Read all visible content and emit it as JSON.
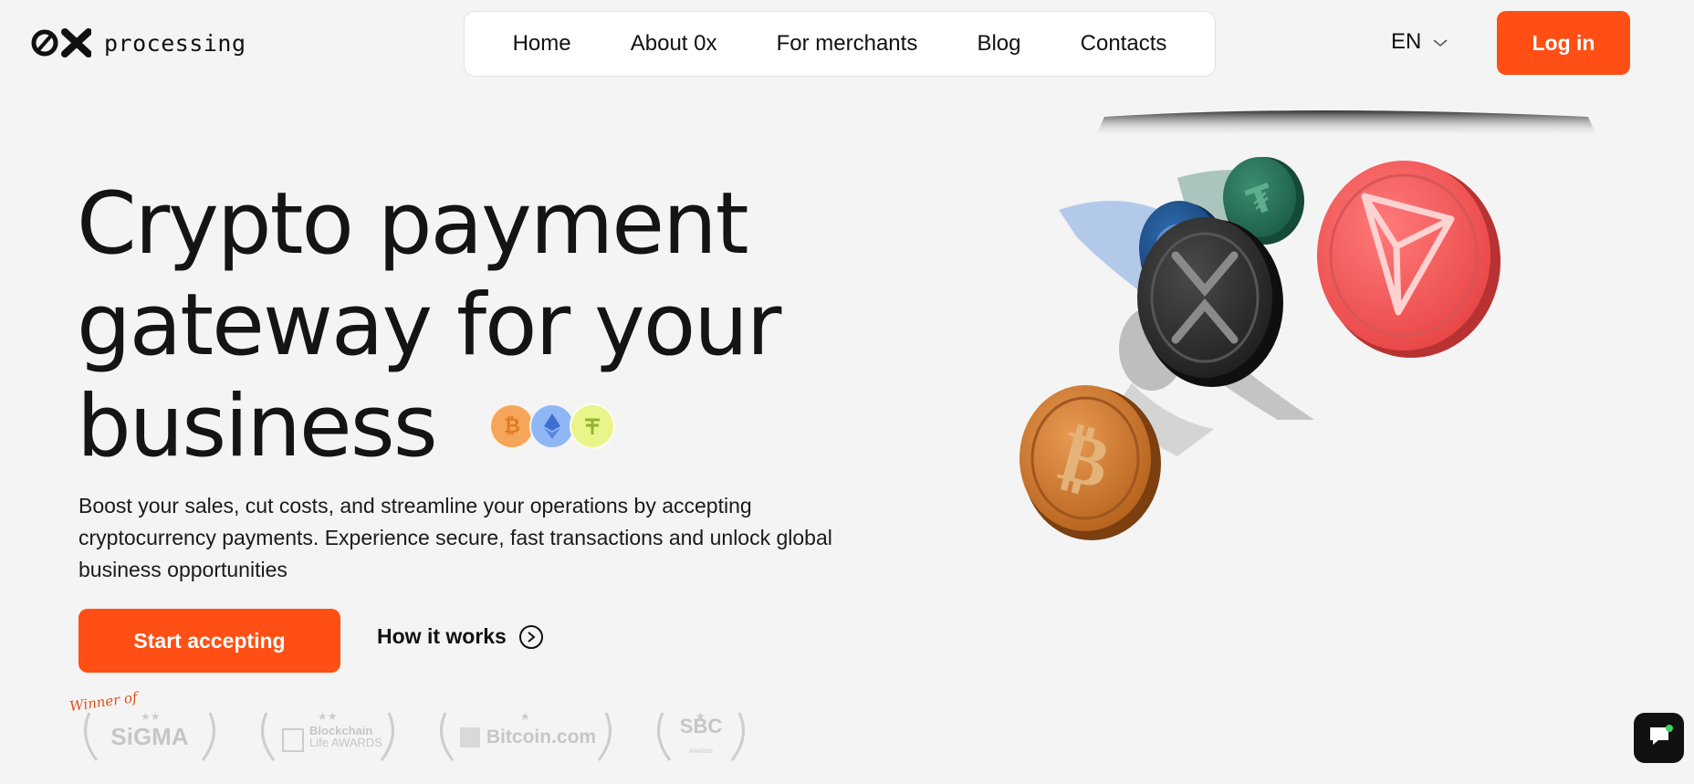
{
  "header": {
    "logo_text": "processing",
    "nav": [
      {
        "label": "Home"
      },
      {
        "label": "About 0x"
      },
      {
        "label": "For merchants"
      },
      {
        "label": "Blog"
      },
      {
        "label": "Contacts"
      }
    ],
    "language": "EN",
    "login_label": "Log in"
  },
  "hero": {
    "title_lines": [
      "Crypto payment",
      "gateway for your",
      "business"
    ],
    "coin_icons": [
      "bitcoin-icon",
      "ethereum-icon",
      "tether-icon"
    ],
    "description": "Boost your sales, cut costs, and streamline your operations by accepting cryptocurrency payments. Experience secure, fast transactions and unlock global business opportunities",
    "start_label": "Start accepting",
    "how_label": "How it works"
  },
  "awards": {
    "winner_label": "Winner of",
    "items": [
      {
        "name": "SiGMA"
      },
      {
        "name": "Blockchain",
        "sub": "Life AWARDS"
      },
      {
        "name": "Bitcoin.com"
      },
      {
        "name": "SBC",
        "sub": "AWARDS"
      }
    ]
  },
  "illustration": {
    "coins": [
      "tron-icon",
      "xrp-icon",
      "bitcoin-icon",
      "usdc-icon",
      "tether-icon"
    ]
  },
  "colors": {
    "accent": "#ff4f14",
    "background": "#f4f4f4",
    "text": "#111111"
  }
}
